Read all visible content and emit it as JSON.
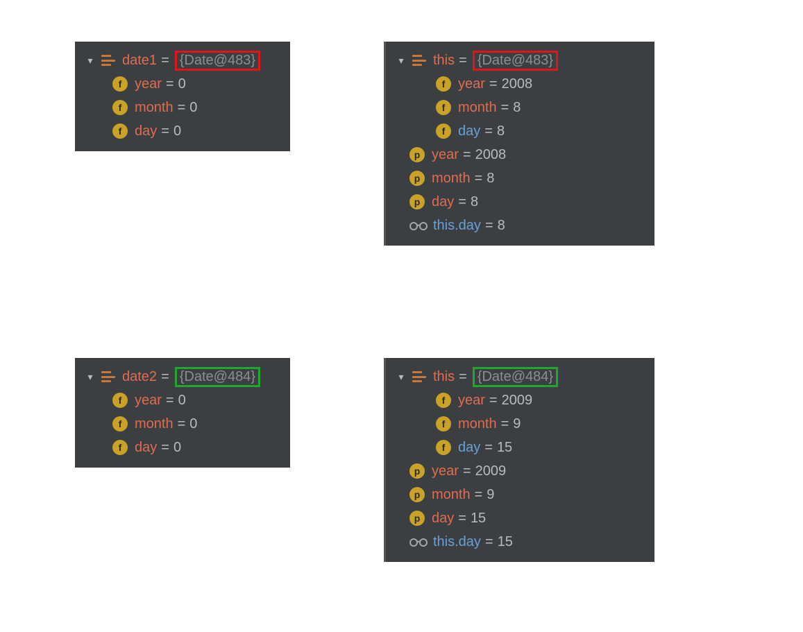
{
  "panels": {
    "tl": {
      "highlight": "red",
      "head": {
        "var": "date1",
        "ref": "{Date@483}"
      },
      "fields": [
        {
          "kind": "f",
          "name": "year",
          "style": "orange",
          "value": "0"
        },
        {
          "kind": "f",
          "name": "month",
          "style": "orange",
          "value": "0"
        },
        {
          "kind": "f",
          "name": "day",
          "style": "orange",
          "value": "0"
        }
      ]
    },
    "tr": {
      "highlight": "red",
      "head": {
        "var": "this",
        "ref": "{Date@483}"
      },
      "fields": [
        {
          "kind": "f",
          "name": "year",
          "style": "orange",
          "value": "2008"
        },
        {
          "kind": "f",
          "name": "month",
          "style": "orange",
          "value": "8"
        },
        {
          "kind": "f",
          "name": "day",
          "style": "blue",
          "value": "8"
        }
      ],
      "params": [
        {
          "kind": "p",
          "name": "year",
          "style": "orange",
          "value": "2008"
        },
        {
          "kind": "p",
          "name": "month",
          "style": "orange",
          "value": "8"
        },
        {
          "kind": "p",
          "name": "day",
          "style": "orange",
          "value": "8"
        }
      ],
      "watch": {
        "name": "this.day",
        "style": "blue",
        "value": "8"
      }
    },
    "bl": {
      "highlight": "green",
      "head": {
        "var": "date2",
        "ref": "{Date@484}"
      },
      "fields": [
        {
          "kind": "f",
          "name": "year",
          "style": "orange",
          "value": "0"
        },
        {
          "kind": "f",
          "name": "month",
          "style": "orange",
          "value": "0"
        },
        {
          "kind": "f",
          "name": "day",
          "style": "orange",
          "value": "0"
        }
      ]
    },
    "br": {
      "highlight": "green",
      "head": {
        "var": "this",
        "ref": "{Date@484}"
      },
      "fields": [
        {
          "kind": "f",
          "name": "year",
          "style": "orange",
          "value": "2009"
        },
        {
          "kind": "f",
          "name": "month",
          "style": "orange",
          "value": "9"
        },
        {
          "kind": "f",
          "name": "day",
          "style": "blue",
          "value": "15"
        }
      ],
      "params": [
        {
          "kind": "p",
          "name": "year",
          "style": "orange",
          "value": "2009"
        },
        {
          "kind": "p",
          "name": "month",
          "style": "orange",
          "value": "9"
        },
        {
          "kind": "p",
          "name": "day",
          "style": "orange",
          "value": "15"
        }
      ],
      "watch": {
        "name": "this.day",
        "style": "blue",
        "value": "15"
      }
    }
  }
}
